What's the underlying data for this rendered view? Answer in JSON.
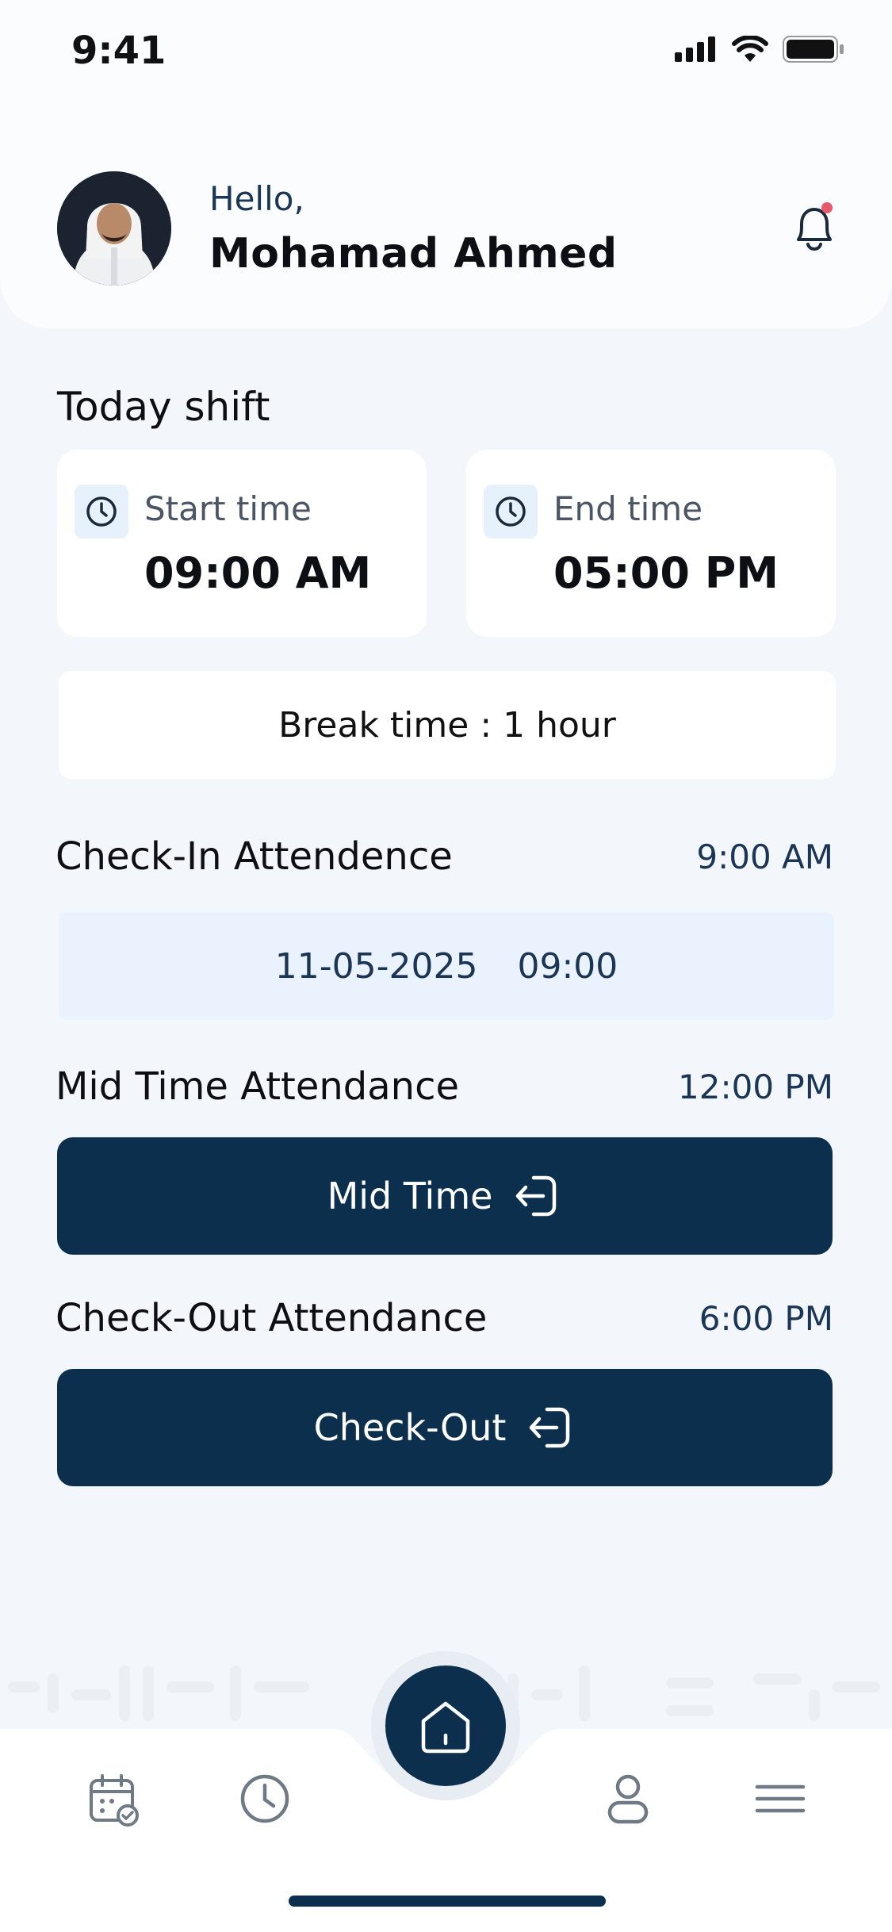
{
  "status_bar": {
    "time": "9:41"
  },
  "header": {
    "greeting": "Hello,",
    "user_name": "Mohamad Ahmed"
  },
  "today_shift": {
    "title": "Today shift",
    "start": {
      "label": "Start time",
      "value": "09:00 AM"
    },
    "end": {
      "label": "End time",
      "value": "05:00 PM"
    },
    "break_text": "Break time : 1 hour"
  },
  "checkin": {
    "title": "Check-In Attendence",
    "time": "9:00 AM",
    "date": "11-05-2025",
    "clock": "09:00"
  },
  "midtime": {
    "title": "Mid Time Attendance",
    "time": "12:00 PM",
    "button_label": "Mid Time"
  },
  "checkout": {
    "title": "Check-Out Attendance",
    "time": "6:00 PM",
    "button_label": "Check-Out"
  },
  "colors": {
    "primary": "#0b2f4d",
    "background": "#f3f6fa",
    "accent_dot": "#e85a6b"
  },
  "nav": [
    "calendar-icon",
    "clock-icon",
    "home-icon",
    "profile-icon",
    "menu-icon"
  ]
}
